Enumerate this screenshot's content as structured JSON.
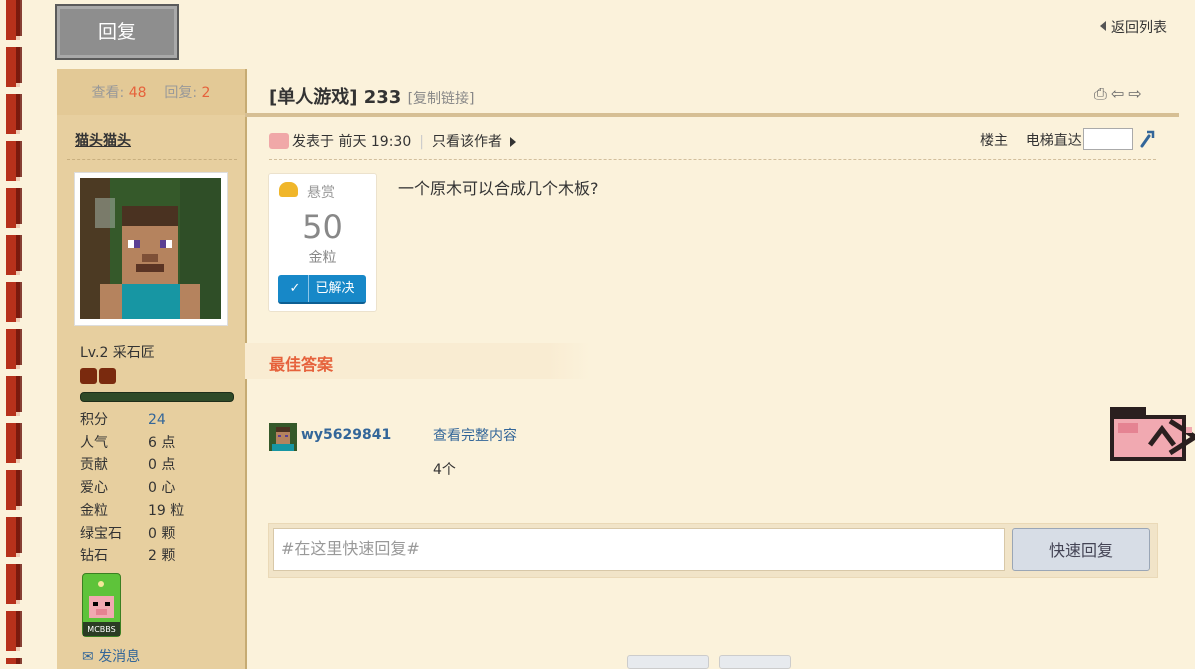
{
  "top": {
    "reply_button": "回复",
    "back_link": "返回列表"
  },
  "author": {
    "views_label": "查看:",
    "views": "48",
    "replies_label": "回复:",
    "replies": "2",
    "username": "猫头猫头",
    "level": "Lv.2 采石匠",
    "stats": [
      {
        "key": "积分",
        "value": "24"
      },
      {
        "key": "人气",
        "value": "6 点"
      },
      {
        "key": "贡献",
        "value": "0 点"
      },
      {
        "key": "爱心",
        "value": "0 心"
      },
      {
        "key": "金粒",
        "value": "19 粒"
      },
      {
        "key": "绿宝石",
        "value": "0 颗"
      },
      {
        "key": "钻石",
        "value": "2 颗"
      }
    ],
    "badge_text": "MCBBS",
    "send_message": "发消息"
  },
  "post": {
    "title": "[单人游戏] 233",
    "copy_link": "[复制链接]",
    "posted": "发表于 前天 19:30",
    "only_author": "只看该作者",
    "floor_label": "楼主",
    "elevator_label": "电梯直达",
    "question": "一个原木可以合成几个木板?",
    "bounty": {
      "label": "悬赏",
      "amount": "50",
      "unit": "金粒",
      "status": "已解决",
      "check": "✓"
    },
    "best_answer_label": "最佳答案",
    "answer": {
      "user": "wy5629841",
      "view_full": "查看完整内容",
      "text": "4个"
    }
  },
  "quick_reply": {
    "placeholder": "#在这里快速回复#",
    "button": "快速回复"
  },
  "colors": {
    "accent": "#e6623c",
    "link": "#336699",
    "sidebar": "#e7cf9f",
    "page": "#fbf2db"
  }
}
